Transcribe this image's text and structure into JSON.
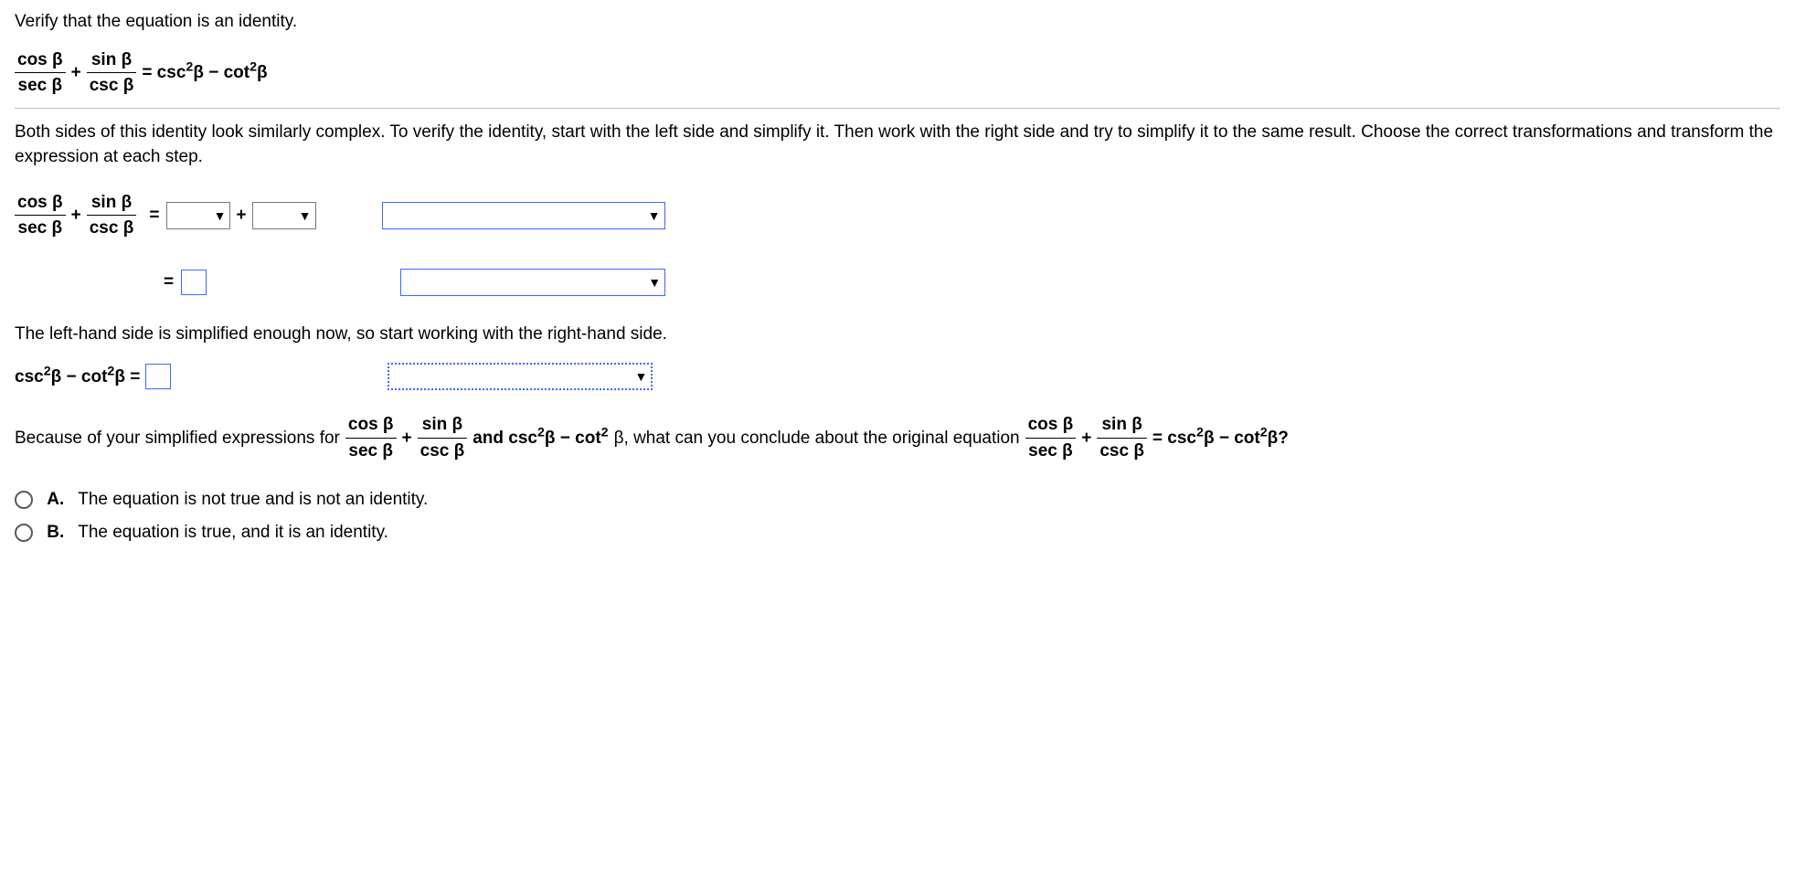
{
  "q": {
    "prompt": "Verify that the equation is an identity.",
    "eq_lhs_f1_num": "cos β",
    "eq_lhs_f1_den": "sec β",
    "eq_plus": "+",
    "eq_lhs_f2_num": "sin β",
    "eq_lhs_f2_den": "csc β",
    "eq_rhs": "= csc",
    "eq_rhs2": "β − cot",
    "eq_rhs3": "β",
    "explain": "Both sides of this identity look similarly complex. To verify the identity, start with the left side and simplify it. Then work with the right side and try to simplify it to the same result. Choose the correct transformations and transform the expression at each step.",
    "equals": "=",
    "lhs_done": "The left-hand side is simplified enough now, so start working with the right-hand side.",
    "csc_cot_lhs1": "csc",
    "csc_cot_lhs2": "β − cot",
    "csc_cot_lhs3": "β =",
    "because1": "Because of your simplified expressions for ",
    "because2": " and csc",
    "because3": "β − cot",
    "because4": "β, what can you conclude about the original equation ",
    "because5": " = csc",
    "because6": "β − cot",
    "because7": "β?",
    "optA_letter": "A.",
    "optA": "The equation is not true and is not an identity.",
    "optB_letter": "B.",
    "optB": "The equation is true, and it is an identity."
  }
}
